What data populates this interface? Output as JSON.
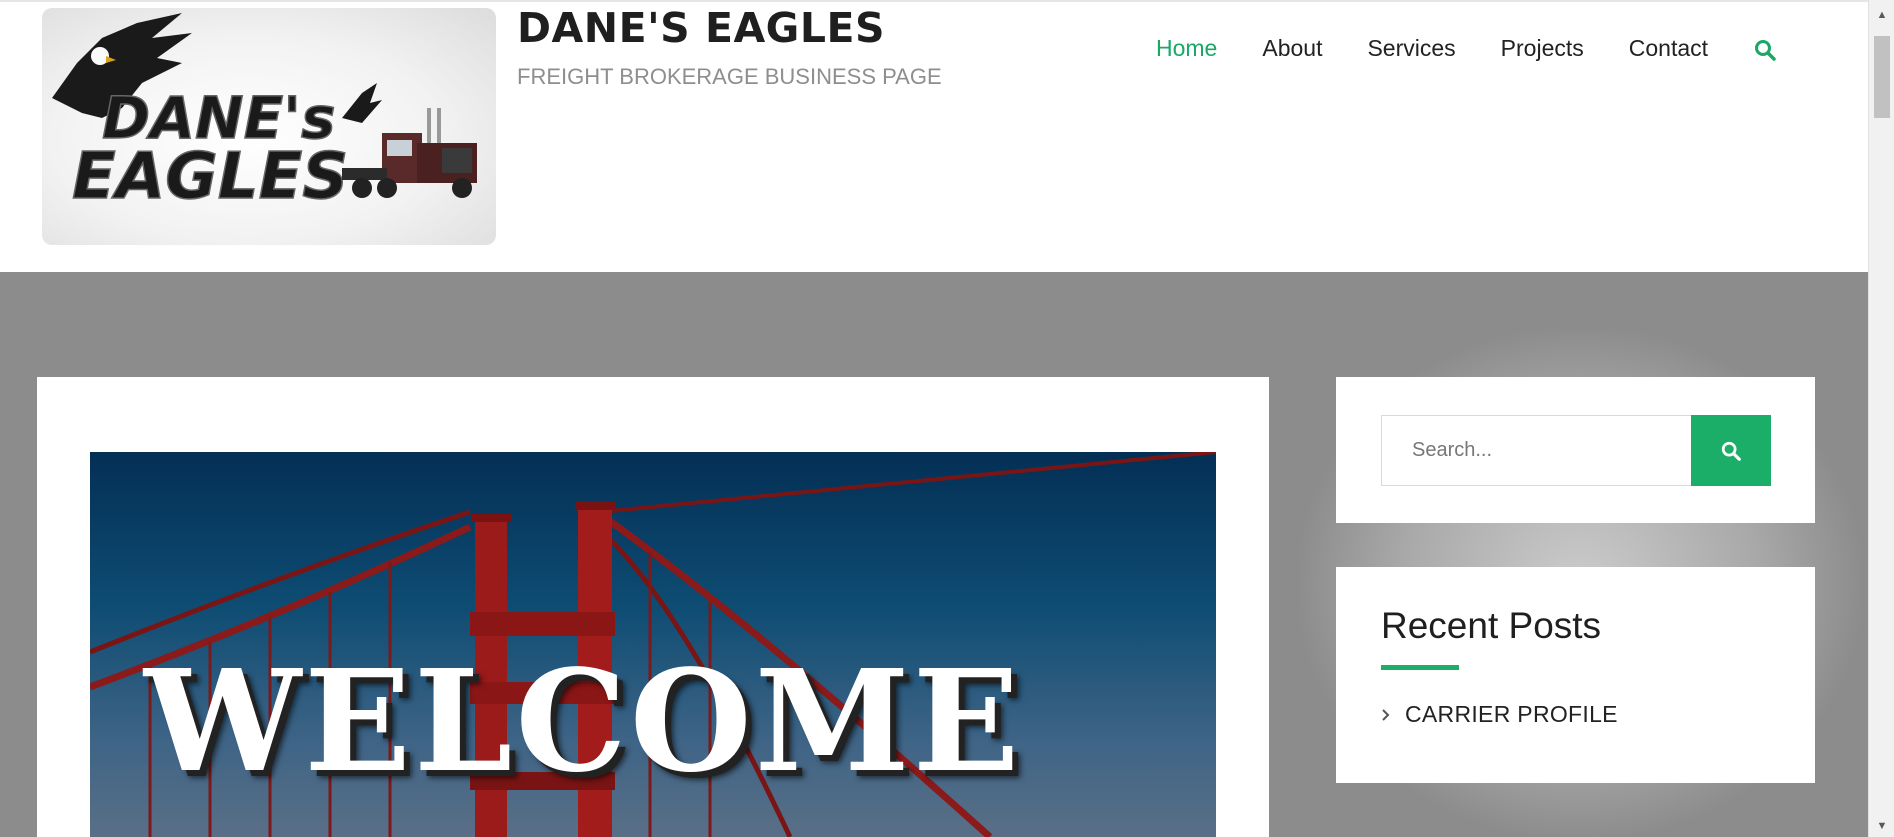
{
  "header": {
    "logo_text": "DANE's EAGLES",
    "site_title": "DANE'S EAGLES",
    "tagline": "FREIGHT BROKERAGE BUSINESS PAGE"
  },
  "nav": {
    "items": [
      {
        "label": "Home",
        "active": true
      },
      {
        "label": "About",
        "active": false
      },
      {
        "label": "Services",
        "active": false
      },
      {
        "label": "Projects",
        "active": false
      },
      {
        "label": "Contact",
        "active": false
      }
    ],
    "search_icon": "search-icon"
  },
  "hero": {
    "text": "WELCOME"
  },
  "sidebar": {
    "search": {
      "placeholder": "Search...",
      "button_icon": "search-icon"
    },
    "recent_posts": {
      "title": "Recent Posts",
      "items": [
        "CARRIER PROFILE"
      ]
    }
  },
  "colors": {
    "accent": "#1aae68",
    "header_bg": "#ffffff",
    "page_bg": "#8c8c8c"
  }
}
